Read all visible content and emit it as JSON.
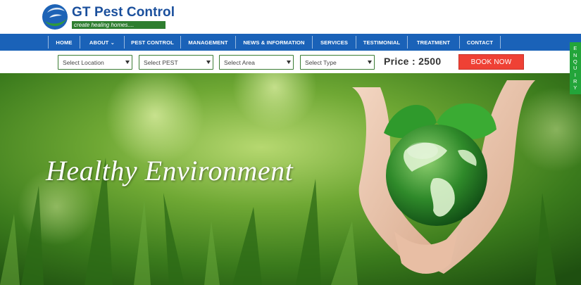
{
  "header": {
    "brand": "GT Pest Control",
    "tagline": "create healing homes....",
    "logo_icon": "globe-swoosh-icon"
  },
  "nav": {
    "items": [
      {
        "label": "HOME"
      },
      {
        "label": "ABOUT  ⌄"
      },
      {
        "label": "PEST CONTROL"
      },
      {
        "label": "MANAGEMENT"
      },
      {
        "label": "NEWS & INFORMATION"
      },
      {
        "label": "SERVICES"
      },
      {
        "label": "TESTIMONIAL"
      },
      {
        "label": "TREATMENT"
      },
      {
        "label": "CONTACT"
      }
    ]
  },
  "filters": {
    "location": "Select Location",
    "pest": "Select PEST",
    "area": "Select Area",
    "type": "Select Type"
  },
  "price": "Price : 2500",
  "book_label": "BOOK NOW",
  "enquiry": [
    "E",
    "N",
    "Q",
    "U",
    "I",
    "R",
    "Y"
  ],
  "hero": {
    "title": "Healthy Environment",
    "image": "hands-holding-green-globe-icon"
  },
  "colors": {
    "nav_bg": "#1a62b8",
    "brand_blue": "#1a4f9c",
    "tagline_green": "#2f7e30",
    "book_red": "#ef4135",
    "enquiry_green": "#23a53a"
  }
}
